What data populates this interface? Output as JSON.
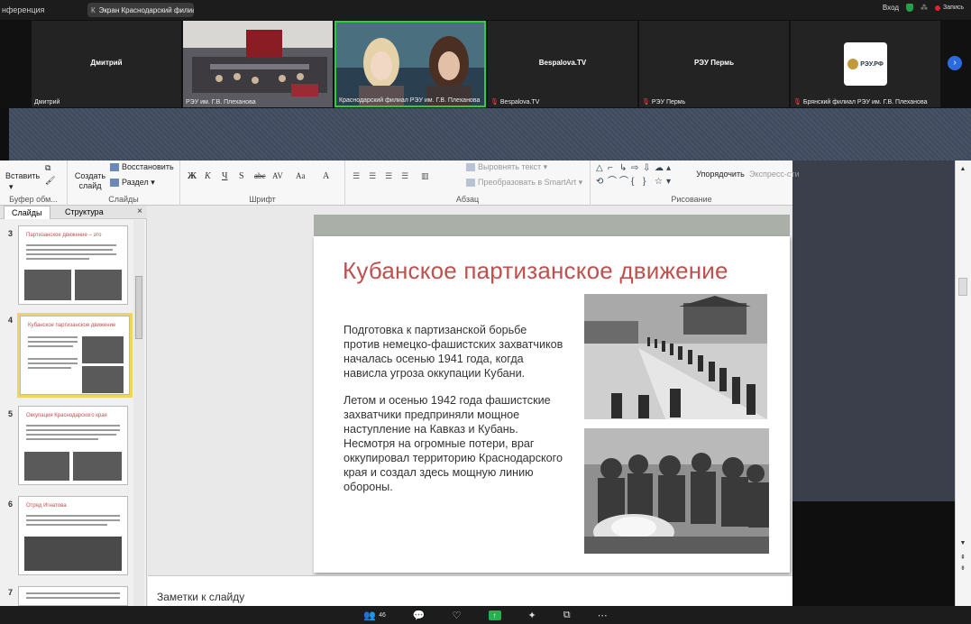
{
  "topbar": {
    "meeting_title": "нференция",
    "share_tab_letter": "К",
    "share_tab_label": "Экран Краснодарский филиал",
    "signin": "Вход",
    "record_label": "Запись"
  },
  "participants": {
    "tiles": [
      {
        "center_name": "Дмитрий",
        "caption": "Дмитрий",
        "muted": false
      },
      {
        "center_name": "",
        "caption": "РЭУ им. Г.В. Плеханова",
        "muted": false
      },
      {
        "center_name": "",
        "caption": "Краснодарский филиал РЭУ им. Г.В. Плеханова",
        "muted": false
      },
      {
        "center_name": "Bespalova.TV",
        "caption": "Bespalova.TV",
        "muted": true
      },
      {
        "center_name": "РЭУ Пермь",
        "caption": "РЭУ Пермь",
        "muted": true
      },
      {
        "center_name": "",
        "caption": "Брянский филиал РЭУ им. Г.В. Плеханова",
        "muted": true
      }
    ],
    "logo_text": "РЭУ.РФ",
    "next_icon": "chevron-right-icon"
  },
  "ribbon": {
    "paste": "Вставить",
    "create_slide": "Создать слайд",
    "restore": "Восстановить",
    "section": "Раздел",
    "group_clipboard": "Буфер обм...",
    "group_slides": "Слайды",
    "group_font": "Шрифт",
    "group_paragraph": "Абзац",
    "group_drawing": "Рисование",
    "align_text": "Выровнять текст",
    "convert_smartart": "Преобразовать в SmartArt",
    "arrange": "Упорядочить",
    "express_styles": "Экспресс-сти",
    "font_buttons": [
      "Ж",
      "К",
      "Ч",
      "S",
      "abc",
      "AV",
      "Aa",
      "A"
    ]
  },
  "slide_pane": {
    "tab_slides": "Слайды",
    "tab_outline": "Структура",
    "close": "×",
    "thumbs": [
      {
        "num": "3",
        "title": "Партизанское движение – это"
      },
      {
        "num": "4",
        "title": "Кубанское партизанское движение"
      },
      {
        "num": "5",
        "title": "Оккупация Краснодарского края"
      },
      {
        "num": "6",
        "title": "Отряд Игнатова"
      },
      {
        "num": "7",
        "title": ""
      }
    ]
  },
  "slide": {
    "title": "Кубанское партизанское движение",
    "paragraph1": "Подготовка к партизанской борьбе против немецко-фашистских захватчиков началась осенью 1941 года, когда нависла угроза оккупации Кубани.",
    "paragraph2": "Летом и осенью 1942 года фашистские захватчики предприняли мощное наступление на Кавказ и Кубань. Несмотря на огромные потери, враг оккупировал территорию Краснодарского края и создал здесь мощную линию обороны."
  },
  "notes": {
    "placeholder": "Заметки к слайду"
  },
  "bottombar": {
    "participants_count": "46"
  }
}
